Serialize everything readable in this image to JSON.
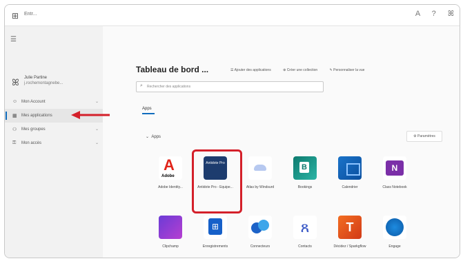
{
  "topbar": {
    "brand": "Entr...",
    "icons": [
      "grid-icon",
      "alert-icon",
      "help-icon",
      "user-icon"
    ],
    "right_glyphs": [
      "A",
      "?",
      "ꕤ"
    ]
  },
  "sidebar": {
    "user_name": "Julie Partine",
    "user_email": "j.rochemontagnebe...",
    "items": [
      {
        "label": "Mon Account",
        "icon": "user-icon"
      },
      {
        "label": "Mes applications",
        "icon": "apps-icon",
        "active": true
      },
      {
        "label": "Mes groupes",
        "icon": "group-icon"
      },
      {
        "label": "Mon accès",
        "icon": "lock-icon"
      }
    ]
  },
  "header": {
    "title": "Tableau de bord ...",
    "actions": [
      "Ajouter des applications",
      "Créer une collection",
      "Personnaliser la vue"
    ]
  },
  "search": {
    "placeholder": "Rechercher des applications"
  },
  "tabs": [
    "Apps"
  ],
  "section": {
    "label": "Apps",
    "params_label": "Paramètres"
  },
  "apps": [
    {
      "label": "Adobe Identity...",
      "icon": "adobe-icon"
    },
    {
      "label": "Antidote Pro - Equipe...",
      "icon": "antidote-icon",
      "logo_text": "Antidote Pro"
    },
    {
      "label": "Atlas by Windsurd",
      "icon": "cloud-icon"
    },
    {
      "label": "Bookings",
      "icon": "bookings-icon"
    },
    {
      "label": "Calendrier",
      "icon": "calendar-icon"
    },
    {
      "label": "Class Notebook",
      "icon": "onenote-icon"
    },
    {
      "label": "Clipchamp",
      "icon": "clipchamp-icon"
    },
    {
      "label": "Enregistrements",
      "icon": "store-icon"
    },
    {
      "label": "Connecteurs",
      "icon": "connect-icon"
    },
    {
      "label": "Contacts",
      "icon": "contacts-icon"
    },
    {
      "label": "Décidez / Sparkgflow",
      "icon": "tutor-icon"
    },
    {
      "label": "Engage",
      "icon": "engage-icon"
    }
  ],
  "colors": {
    "accent": "#0f6cbd",
    "highlight": "#d4202a"
  }
}
